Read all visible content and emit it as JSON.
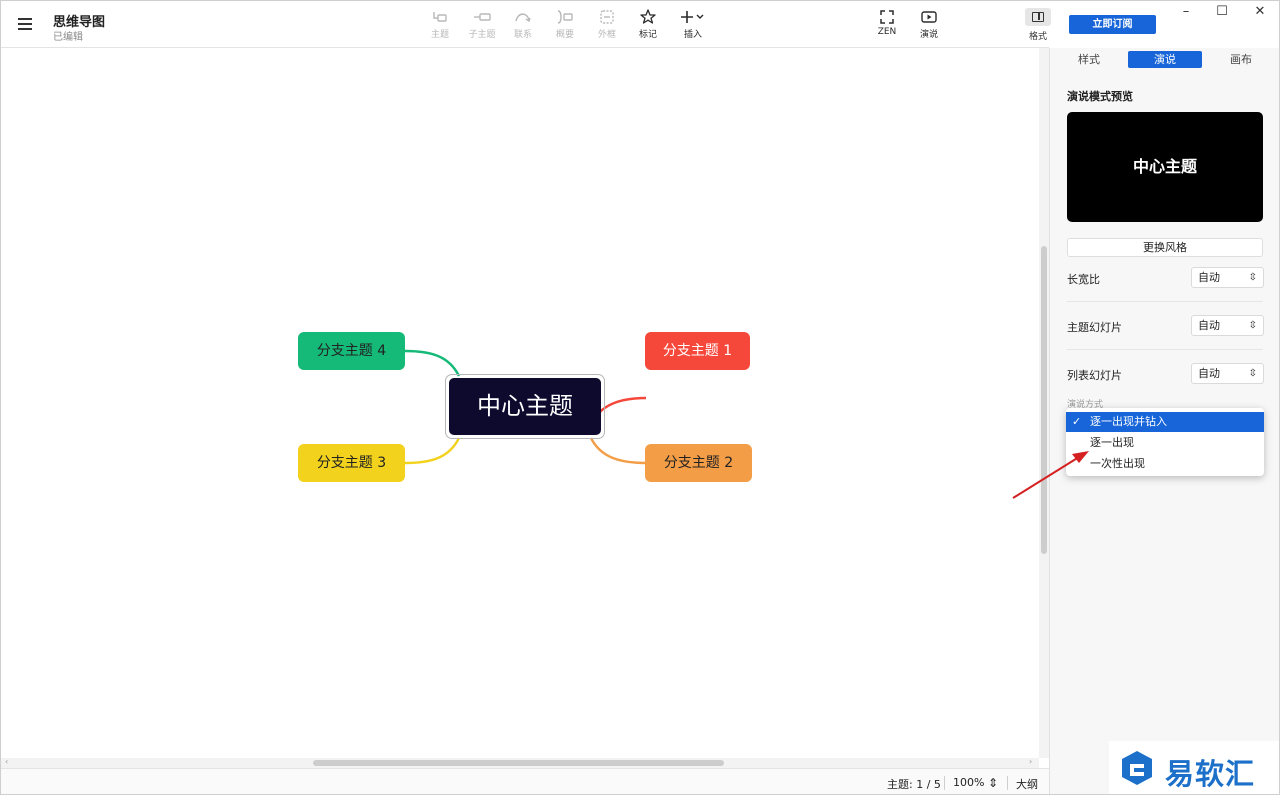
{
  "header": {
    "title": "思维导图",
    "status": "已编辑"
  },
  "toolbar": {
    "topic": "主题",
    "subtopic": "子主题",
    "relation": "联系",
    "summary": "概要",
    "boundary": "外框",
    "marker": "标记",
    "insert": "插入",
    "zen": "ZEN",
    "present": "演说",
    "format": "格式"
  },
  "subscribe": "立即订阅",
  "window": {
    "minimize": "–",
    "maximize": "☐",
    "close": "✕"
  },
  "mindmap": {
    "center": "中心主题",
    "branches": [
      "分支主题 1",
      "分支主题 2",
      "分支主题 3",
      "分支主题 4"
    ],
    "colors": {
      "b1": "#f5483b",
      "b2": "#f39d46",
      "b3": "#f2d21c",
      "b4": "#15b978",
      "center": "#0d0a2e"
    }
  },
  "status": {
    "topics": "主题: 1 / 5",
    "zoom": "100%",
    "outline": "大纲"
  },
  "panel": {
    "tabs": [
      "样式",
      "演说",
      "画布"
    ],
    "active_tab": "演说",
    "preview_title": "演说模式预览",
    "preview_text": "中心主题",
    "change_style": "更换风格",
    "aspect_label": "长宽比",
    "aspect_value": "自动",
    "topic_slide_label": "主题幻灯片",
    "topic_slide_value": "自动",
    "list_slide_label": "列表幻灯片",
    "list_slide_value": "自动",
    "mode_label": "演说方式",
    "mode_options": [
      "逐一出现并钻入",
      "逐一出现",
      "一次性出现"
    ],
    "mode_selected": "逐一出现并钻入"
  },
  "watermark": {
    "text": "易软汇"
  },
  "accent": "#1765d8"
}
